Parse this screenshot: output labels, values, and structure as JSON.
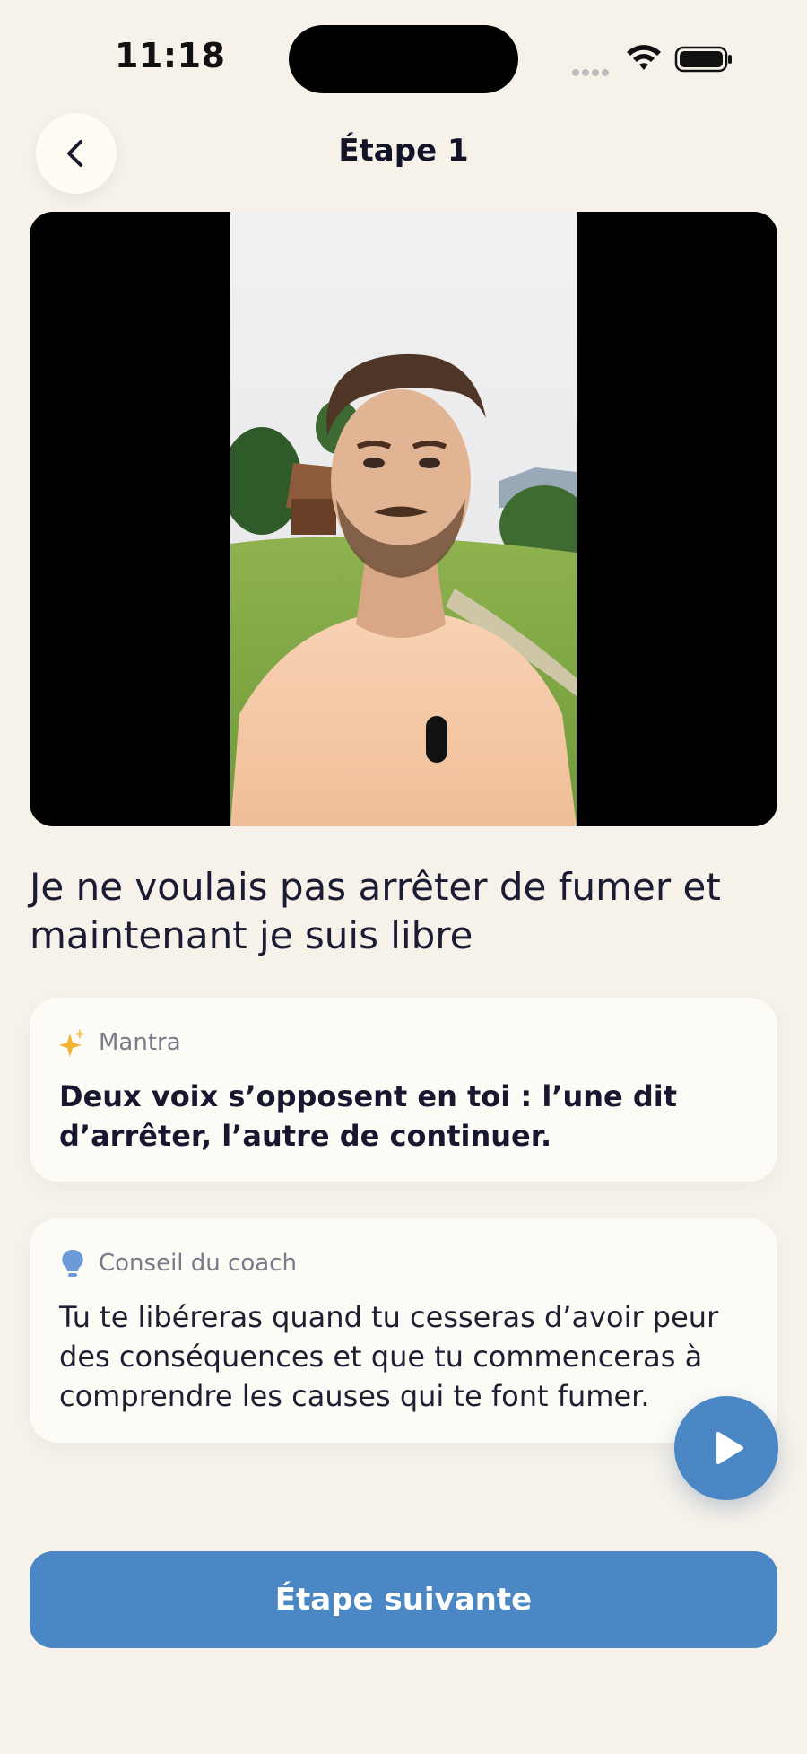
{
  "status_bar": {
    "time": "11:18"
  },
  "header": {
    "title": "Étape 1"
  },
  "step": {
    "heading": "Je ne voulais pas arrêter de fumer et maintenant je suis libre"
  },
  "mantra": {
    "label": "Mantra",
    "text": "Deux voix s’opposent en toi : l’une dit d’arrêter, l’autre de continuer."
  },
  "coach": {
    "label": "Conseil du coach",
    "text": "Tu te libéreras quand tu cesseras d’avoir peur des conséquences et que tu commenceras à comprendre les causes qui te font fumer."
  },
  "actions": {
    "next_label": "Étape suivante"
  },
  "colors": {
    "background": "#F6F2EA",
    "accent": "#4B87C4",
    "sparkle": "#F2B233",
    "bulb": "#6D9BDA"
  },
  "icons": [
    "back-chevron-icon",
    "sparkles-icon",
    "lightbulb-icon",
    "play-icon",
    "wifi-icon",
    "battery-icon"
  ]
}
